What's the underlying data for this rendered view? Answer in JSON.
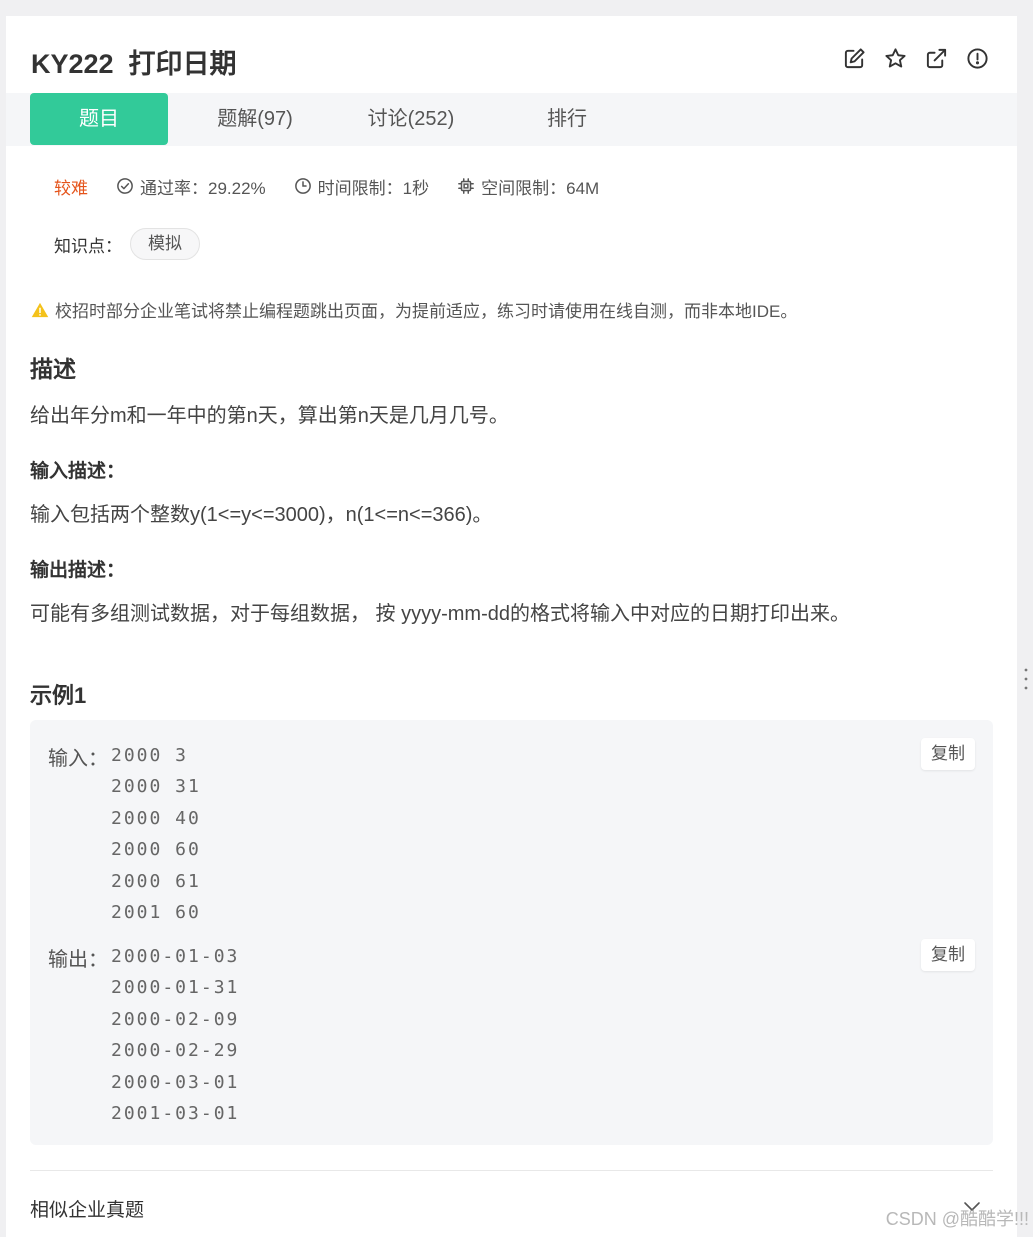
{
  "problem": {
    "title": "KY222  打印日期",
    "header_icons": [
      "edit-icon",
      "star-icon",
      "external-link-icon",
      "report-icon"
    ]
  },
  "tabs": [
    {
      "label": "题目",
      "active": true
    },
    {
      "label": "题解(97)",
      "active": false
    },
    {
      "label": "讨论(252)",
      "active": false
    },
    {
      "label": "排行",
      "active": false
    }
  ],
  "meta": {
    "difficulty": "较难",
    "pass_rate": "通过率：29.22%",
    "time_limit": "时间限制：1秒",
    "space_limit": "空间限制：64M"
  },
  "knowledge": {
    "label": "知识点：",
    "tags": [
      "模拟"
    ]
  },
  "notice": "校招时部分企业笔试将禁止编程题跳出页面，为提前适应，练习时请使用在线自测，而非本地IDE。",
  "description": {
    "heading": "描述",
    "text": "给出年分m和一年中的第n天，算出第n天是几月几号。"
  },
  "input_desc": {
    "heading": "输入描述：",
    "text": "输入包括两个整数y(1<=y<=3000)，n(1<=n<=366)。"
  },
  "output_desc": {
    "heading": "输出描述：",
    "text": "可能有多组测试数据，对于每组数据， 按 yyyy-mm-dd的格式将输入中对应的日期打印出来。"
  },
  "example": {
    "heading": "示例1",
    "input_label": "输入：",
    "input_lines": [
      "2000 3",
      "2000 31",
      "2000 40",
      "2000 60",
      "2000 61",
      "2001 60"
    ],
    "output_label": "输出：",
    "output_lines": [
      "2000-01-03",
      "2000-01-31",
      "2000-02-09",
      "2000-02-29",
      "2000-03-01",
      "2001-03-01"
    ],
    "copy_label": "复制"
  },
  "similar": {
    "label": "相似企业真题"
  },
  "watermark": "CSDN @酷酷学!!!",
  "colors": {
    "accent": "#32ca99",
    "difficulty": "#e5541b",
    "warning": "#f4c21b"
  }
}
